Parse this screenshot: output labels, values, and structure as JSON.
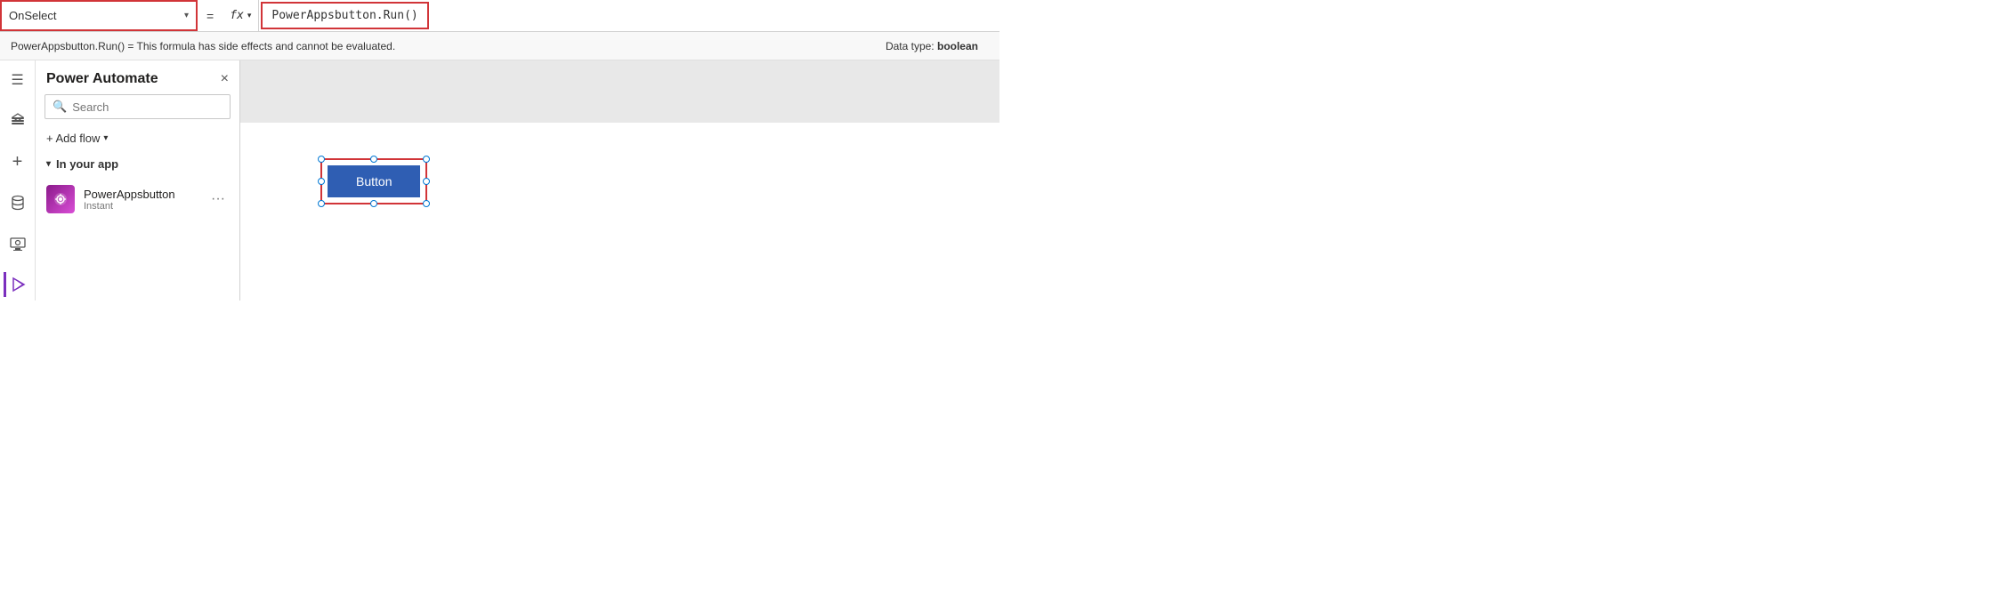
{
  "formula_bar": {
    "property": "OnSelect",
    "formula": "PowerAppsbutton.Run()",
    "error_text": "PowerAppsbutton.Run()  =  This formula has side effects and cannot be evaluated.",
    "data_type_label": "Data type:",
    "data_type_value": "boolean",
    "fx_label": "fx"
  },
  "panel": {
    "title": "Power Automate",
    "close_label": "×",
    "search_placeholder": "Search",
    "add_flow_label": "+ Add flow",
    "section_label": "In your app",
    "flow": {
      "name": "PowerAppsbutton",
      "type": "Instant",
      "more_label": "···"
    }
  },
  "sidebar": {
    "icons": [
      {
        "name": "hamburger-menu-icon",
        "glyph": "☰",
        "active": false
      },
      {
        "name": "layers-icon",
        "glyph": "⧉",
        "active": false
      },
      {
        "name": "add-icon",
        "glyph": "+",
        "active": false
      },
      {
        "name": "database-icon",
        "glyph": "🗄",
        "active": false
      },
      {
        "name": "media-icon",
        "glyph": "🖥",
        "active": false
      },
      {
        "name": "automate-icon",
        "glyph": "⚡",
        "active": true
      }
    ]
  },
  "canvas": {
    "button_label": "Button"
  }
}
